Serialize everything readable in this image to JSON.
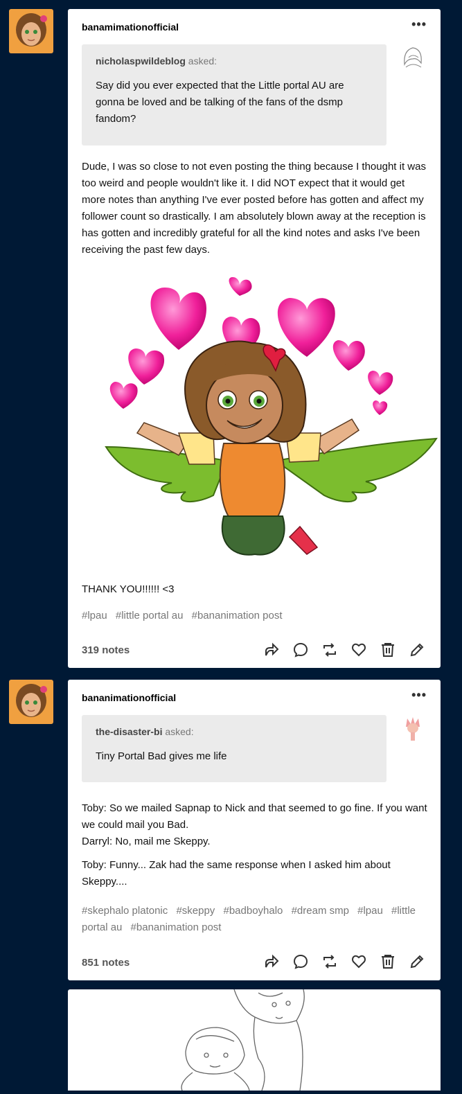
{
  "posts": [
    {
      "author": "banamimationofficial",
      "more_icon": "ellipsis-icon",
      "asker": "nicholaspwildeblog",
      "asked_label": "asked:",
      "question": "Say did you ever expected that the Little portal AU are gonna be loved and be talking of the fans of the dsmp fandom?",
      "answer": [
        "Dude, I was so close to not even posting the thing because I thought it was too weird and people wouldn't like it. I did NOT expect that it would get more notes than anything I've ever posted before has gotten and affect my follower count so drastically. I am absolutely blown away at the reception is has gotten and incredibly grateful for all the kind notes and asks I've been receiving the past few days."
      ],
      "footer_text": "THANK YOU!!!!!! <3",
      "tags": [
        "#lpau",
        "#little portal au",
        "#bananimation post"
      ],
      "notes": "319 notes"
    },
    {
      "author": "bananimationofficial",
      "more_icon": "ellipsis-icon",
      "asker": "the-disaster-bi",
      "asked_label": "asked:",
      "question": "Tiny Portal Bad gives me life",
      "answer": [
        "Toby: So we mailed Sapnap to Nick and that seemed to go fine. If you want we could mail you Bad.",
        "Darryl: No, mail me Skeppy.",
        "Toby: Funny... Zak had the same response when I asked him about Skeppy...."
      ],
      "tags": [
        "#skephalo platonic",
        "#skeppy",
        "#badboyhalo",
        "#dream smp",
        "#lpau",
        "#little portal au",
        "#bananimation post"
      ],
      "notes": "851 notes"
    }
  ],
  "actions": [
    "share-icon",
    "reply-icon",
    "reblog-icon",
    "like-icon",
    "delete-icon",
    "edit-icon"
  ],
  "colors": {
    "background": "#001935",
    "card": "#ffffff",
    "ask_bg": "#ebebeb",
    "tag": "#777777"
  }
}
